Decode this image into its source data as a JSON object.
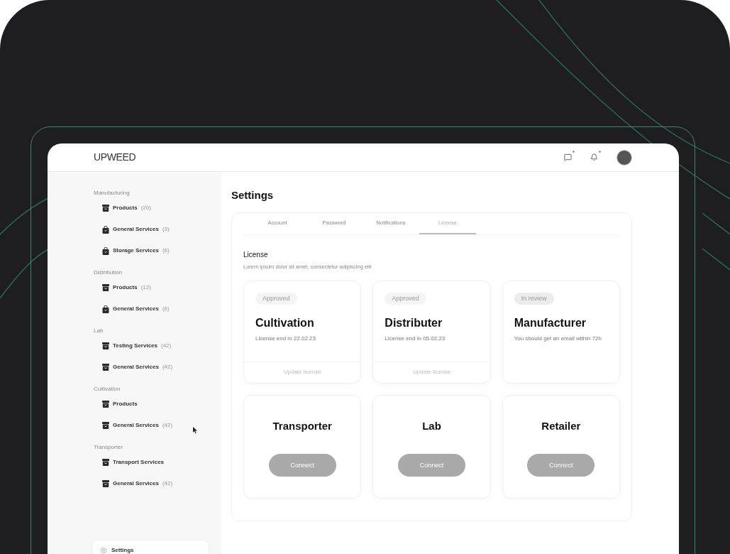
{
  "header": {
    "logo": "UPWEED"
  },
  "sidebar": {
    "sections": [
      {
        "title": "Manufacturing",
        "items": [
          {
            "label": "Products",
            "count": "(20)",
            "kind": "box"
          },
          {
            "label": "General Services",
            "count": "(3)",
            "kind": "bag"
          },
          {
            "label": "Storage Services",
            "count": "(6)",
            "kind": "bag"
          }
        ]
      },
      {
        "title": "Distribution",
        "items": [
          {
            "label": "Products",
            "count": "(12)",
            "kind": "box"
          },
          {
            "label": "General Services",
            "count": "(6)",
            "kind": "bag"
          }
        ]
      },
      {
        "title": "Lab",
        "items": [
          {
            "label": "Testing Services",
            "count": "(42)",
            "kind": "box"
          },
          {
            "label": "General Services",
            "count": "(42)",
            "kind": "box"
          }
        ]
      },
      {
        "title": "Cultivation",
        "items": [
          {
            "label": "Products",
            "kind": "box"
          },
          {
            "label": "General Services",
            "count": "(42)",
            "kind": "box"
          }
        ]
      },
      {
        "title": "Transporter",
        "items": [
          {
            "label": "Transport Services",
            "kind": "box"
          },
          {
            "label": "General Services",
            "count": "(42)",
            "kind": "box"
          }
        ]
      }
    ],
    "settings": {
      "label": "Settings"
    }
  },
  "page": {
    "title": "Settings",
    "tabs": [
      {
        "label": "Account",
        "selected": false
      },
      {
        "label": "Password",
        "selected": false
      },
      {
        "label": "Notifications",
        "selected": false
      },
      {
        "label": "License",
        "selected": true
      }
    ],
    "section": {
      "title": "License",
      "description": "Lorem ipsum dolor sit amet, consectetur adipiscing elit"
    },
    "cards": [
      {
        "kind": "license",
        "status": "Approved",
        "title": "Cultivation",
        "subtitle": "License end in 22.02.23",
        "action": "Update license"
      },
      {
        "kind": "license",
        "status": "Approved",
        "title": "Distributer",
        "subtitle": "License end in 05.02.23",
        "action": "Update license"
      },
      {
        "kind": "license",
        "status": "In review",
        "title": "Manufacturer",
        "subtitle": "You should get an email within 72h"
      },
      {
        "kind": "connect",
        "title": "Transporter",
        "action": "Connect"
      },
      {
        "kind": "connect",
        "title": "Lab",
        "action": "Connect"
      },
      {
        "kind": "connect",
        "title": "Retailer",
        "action": "Connect"
      }
    ]
  }
}
